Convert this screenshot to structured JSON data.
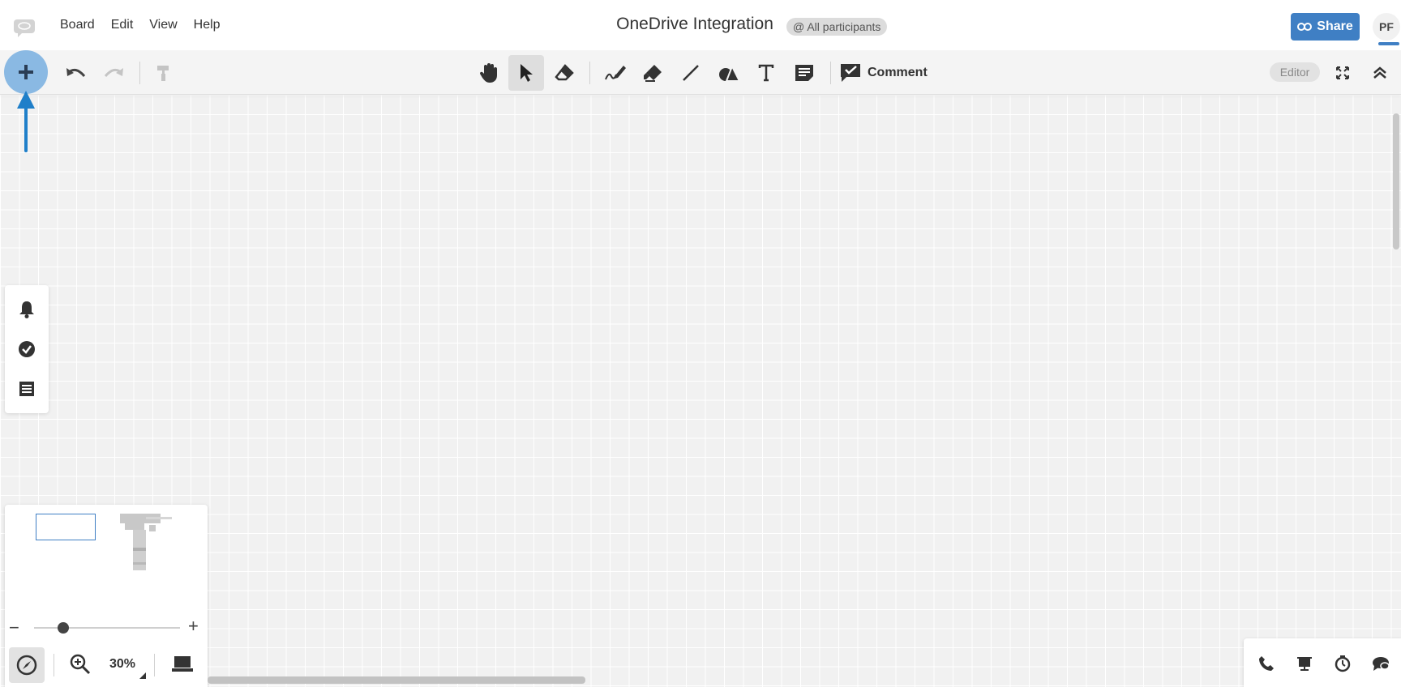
{
  "menu": {
    "items": [
      "Board",
      "Edit",
      "View",
      "Help"
    ]
  },
  "header": {
    "title": "OneDrive Integration",
    "participants_badge": "@ All participants",
    "share_label": "Share",
    "avatar_initials": "PF"
  },
  "toolbar": {
    "comment_label": "Comment",
    "mode_label": "Editor",
    "tools": [
      "hand-icon",
      "select-arrow-icon",
      "eraser-icon",
      "pen-icon",
      "highlighter-icon",
      "line-icon",
      "shapes-icon",
      "text-icon",
      "sticky-note-icon",
      "comment-check-icon"
    ]
  },
  "left_panel": {
    "icons": [
      "bell-icon",
      "check-circle-icon",
      "list-icon"
    ]
  },
  "minimap": {
    "zoom_level": "30%",
    "zoom_fraction": 0.2
  },
  "bottom_right": {
    "icons": [
      "phone-icon",
      "presenter-icon",
      "timer-icon",
      "chat-icon"
    ]
  },
  "colors": {
    "accent": "#3f7fc4",
    "canvas": "#f1f1f1"
  }
}
